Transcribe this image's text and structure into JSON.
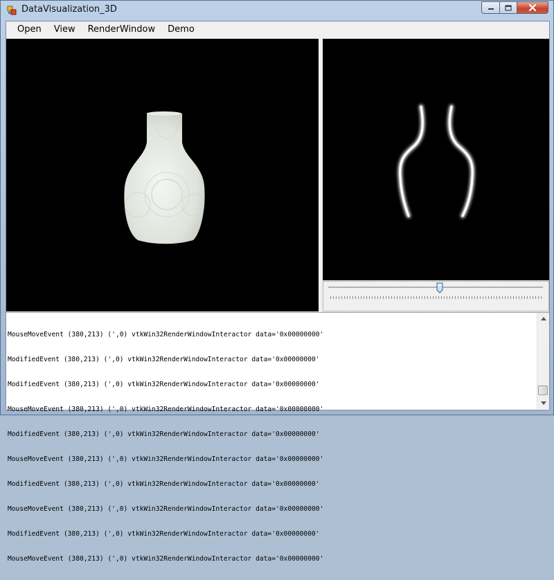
{
  "window": {
    "title": "DataVisualization_3D",
    "accent": "#c7432c"
  },
  "menu": {
    "items": [
      {
        "label": "Open"
      },
      {
        "label": "View"
      },
      {
        "label": "RenderWindow"
      },
      {
        "label": "Demo"
      }
    ]
  },
  "icons": {
    "app": "app-icon",
    "minimize": "minimize-icon",
    "maximize": "maximize-icon",
    "close": "close-icon",
    "scroll_up": "arrow-up-icon",
    "scroll_down": "arrow-down-icon"
  },
  "slider": {
    "value_fraction": 0.52
  },
  "log": {
    "lines": [
      "MouseMoveEvent (380,213) (',0) vtkWin32RenderWindowInteractor data='0x00000000'",
      "ModifiedEvent (380,213) (',0) vtkWin32RenderWindowInteractor data='0x00000000'",
      "ModifiedEvent (380,213) (',0) vtkWin32RenderWindowInteractor data='0x00000000'",
      "MouseMoveEvent (380,213) (',0) vtkWin32RenderWindowInteractor data='0x00000000'",
      "ModifiedEvent (380,213) (',0) vtkWin32RenderWindowInteractor data='0x00000000'",
      "MouseMoveEvent (380,213) (',0) vtkWin32RenderWindowInteractor data='0x00000000'",
      "ModifiedEvent (380,213) (',0) vtkWin32RenderWindowInteractor data='0x00000000'",
      "MouseMoveEvent (380,213) (',0) vtkWin32RenderWindowInteractor data='0x00000000'",
      "ModifiedEvent (380,213) (',0) vtkWin32RenderWindowInteractor data='0x00000000'",
      "MouseMoveEvent (380,213) (',0) vtkWin32RenderWindowInteractor data='0x00000000'"
    ]
  }
}
